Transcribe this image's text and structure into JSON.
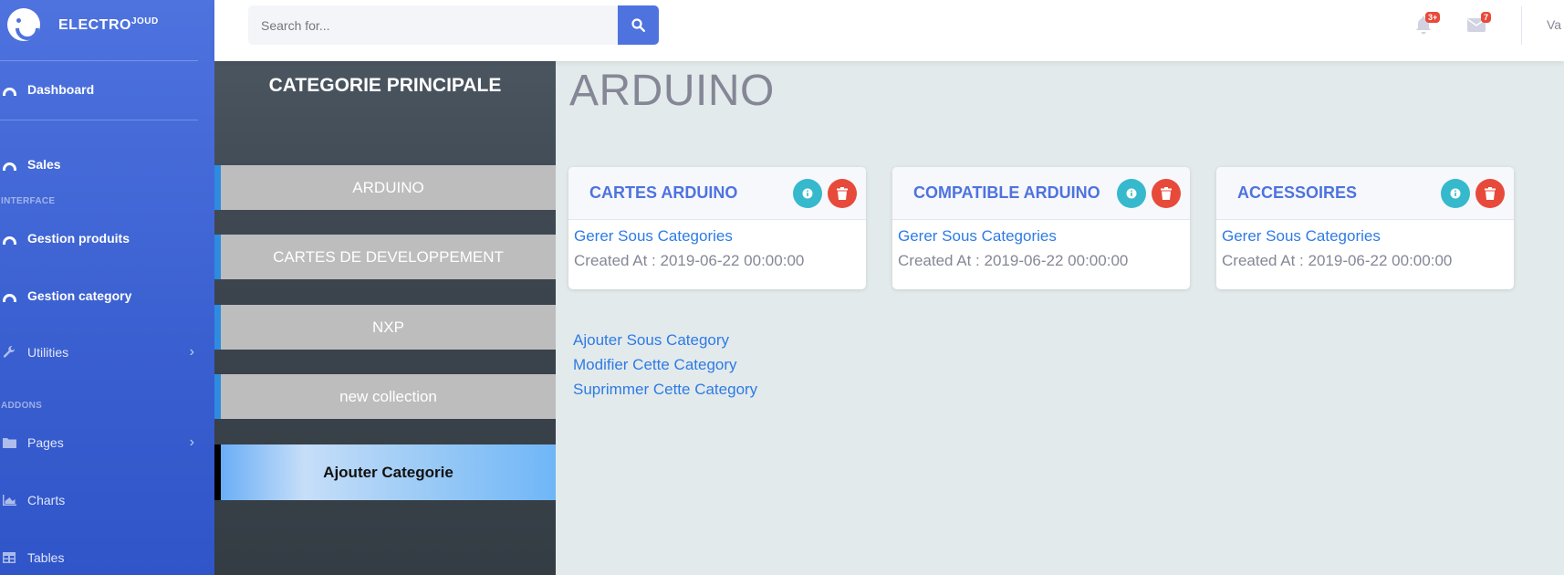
{
  "brand": {
    "name": "ELECTRO",
    "sup": "JOUD"
  },
  "sidebar": {
    "items": [
      {
        "label": "Dashboard",
        "icon": "gauge-icon"
      },
      {
        "label": "Sales",
        "icon": "gauge-icon"
      },
      {
        "label": "Gestion produits",
        "icon": "gauge-icon"
      },
      {
        "label": "Gestion category",
        "icon": "gauge-icon"
      },
      {
        "label": "Utilities",
        "icon": "wrench-icon"
      },
      {
        "label": "Pages",
        "icon": "folder-icon"
      },
      {
        "label": "Charts",
        "icon": "chart-area-icon"
      },
      {
        "label": "Tables",
        "icon": "table-icon"
      }
    ],
    "headings": {
      "interface": "INTERFACE",
      "addons": "ADDONS"
    }
  },
  "topbar": {
    "search_placeholder": "Search for...",
    "alerts_badge": "3+",
    "messages_badge": "7",
    "user_name": "Va"
  },
  "categories": {
    "title": "CATEGORIE PRINCIPALE",
    "items": [
      "ARDUINO",
      "CARTES DE DEVELOPPEMENT",
      "NXP",
      "new collection"
    ],
    "add_label": "Ajouter Categorie"
  },
  "main": {
    "title": "ARDUINO",
    "cards": [
      {
        "title": "CARTES ARDUINO",
        "link": "Gerer Sous Categories",
        "created": "Created At : 2019-06-22 00:00:00"
      },
      {
        "title": "COMPATIBLE ARDUINO",
        "link": "Gerer Sous Categories",
        "created": "Created At : 2019-06-22 00:00:00"
      },
      {
        "title": "ACCESSOIRES",
        "link": "Gerer Sous Categories",
        "created": "Created At : 2019-06-22 00:00:00"
      }
    ],
    "actions": [
      "Ajouter Sous Category",
      "Modifier Cette Category",
      "Suprimmer Cette Category"
    ]
  },
  "colors": {
    "primary": "#4e73df",
    "info": "#36b9cc",
    "danger": "#e74a3b",
    "link": "#2e7be6"
  }
}
